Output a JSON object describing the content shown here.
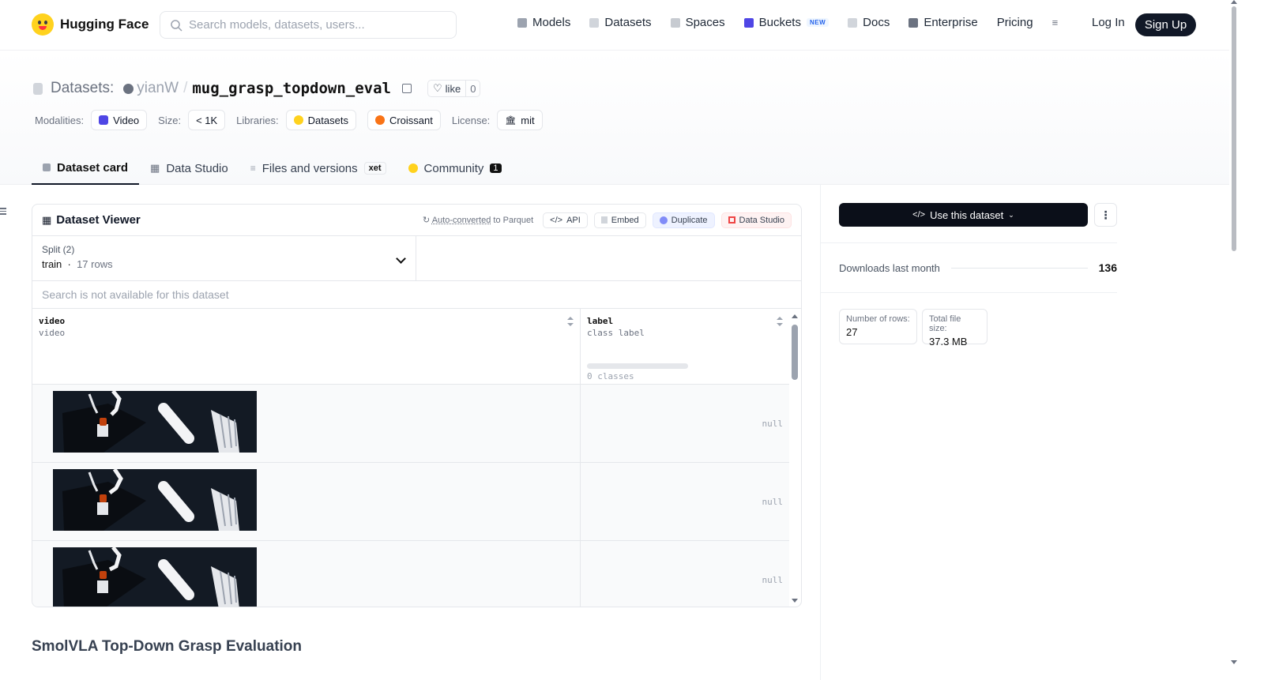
{
  "nav": {
    "brand": "Hugging Face",
    "search_placeholder": "Search models, datasets, users...",
    "links": [
      "Models",
      "Datasets",
      "Spaces",
      "Buckets",
      "Docs",
      "Enterprise",
      "Pricing"
    ],
    "buckets_badge": "NEW",
    "login": "Log In",
    "signup": "Sign Up"
  },
  "header": {
    "section": "Datasets:",
    "user": "yianW",
    "separator": "/",
    "repo": "mug_grasp_topdown_eval",
    "like_label": "like",
    "like_count": "0",
    "meta": {
      "modalities_label": "Modalities:",
      "modality": "Video",
      "size_label": "Size:",
      "size": "< 1K",
      "libraries_label": "Libraries:",
      "libraries": [
        "Datasets",
        "Croissant"
      ],
      "license_label": "License:",
      "license": "mit"
    },
    "tabs": {
      "card": "Dataset card",
      "studio": "Data Studio",
      "files": "Files and versions",
      "xet": "xet",
      "community": "Community",
      "community_count": "1"
    }
  },
  "viewer": {
    "title": "Dataset Viewer",
    "auto_converted_prefix": "Auto-converted",
    "auto_converted_suffix": " to Parquet",
    "api": "API",
    "embed": "Embed",
    "duplicate": "Duplicate",
    "data_studio": "Data Studio",
    "split_label": "Split (2)",
    "split_value": "train",
    "split_rows": "17 rows",
    "search_na": "Search is not available for this dataset",
    "columns": [
      {
        "name": "video",
        "type": "video"
      },
      {
        "name": "label",
        "type": "class label",
        "classes": "0 classes"
      }
    ],
    "rows": [
      {
        "label": "null"
      },
      {
        "label": "null"
      },
      {
        "label": "null"
      }
    ]
  },
  "card": {
    "section_title": "SmolVLA Top-Down Grasp Evaluation"
  },
  "sidebar": {
    "use_button": "Use this dataset",
    "downloads_label": "Downloads last month",
    "downloads_value": "136",
    "rows_label": "Number of rows:",
    "rows_value": "27",
    "filesize_label": "Total file size:",
    "filesize_value": "37.3 MB"
  },
  "colors": {
    "accent_dark": "#111827",
    "brand_yellow": "#ffd21e",
    "video_purple": "#4f46e5",
    "datastudio_red": "#ef4444"
  }
}
